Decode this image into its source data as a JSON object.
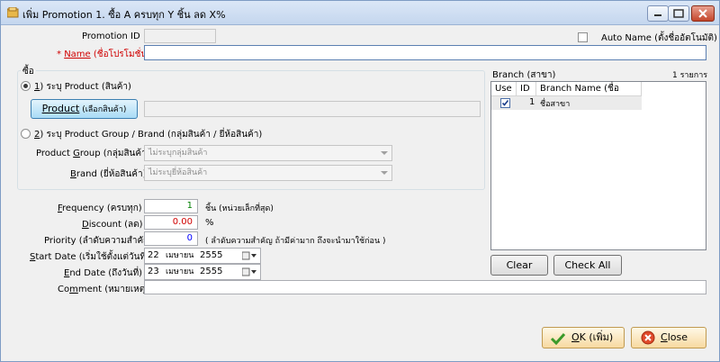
{
  "window": {
    "title": "เพิ่ม Promotion 1. ซื้อ A ครบทุก Y ชิ้น ลด X%"
  },
  "header": {
    "promotion_id_label": "Promotion ID",
    "promotion_id_value": "",
    "auto_name_label": "Auto Name (ตั้งชื่ออัตโนมัติ)",
    "name_asterisk": "* ",
    "name_label": "Name",
    "name_suffix": " (ชื่อโปรโมชั่น)",
    "name_value": ""
  },
  "buy_group": {
    "legend": "ซื้อ",
    "option1_num": "1",
    "option1_text": ") ระบุ Product (สินค้า)",
    "product_button_u": "Product",
    "product_button_rest": " (เลือกสินค้า)",
    "product_value": "",
    "option2_num": "2",
    "option2_text": ") ระบุ Product Group / Brand (กลุ่มสินค้า / ยี่ห้อสินค้า)",
    "product_group_u": "G",
    "product_group_label_pre": "Product ",
    "product_group_label_post": "roup (กลุ่มสินค้า)",
    "product_group_value": "ไม่ระบุกลุ่มสินค้า",
    "brand_u": "B",
    "brand_label_post": "rand (ยี่ห้อสินค้า)",
    "brand_value": "ไม่ระบุยี่ห้อสินค้า"
  },
  "params": {
    "frequency_u": "F",
    "frequency_label_post": "requency (ครบทุก)",
    "frequency_value": "1",
    "frequency_unit": "ชิ้น (หน่วยเล็กที่สุด)",
    "discount_u": "D",
    "discount_label_post": "iscount (ลด)",
    "discount_value": "0.00",
    "discount_unit": "%",
    "priority_label": "Priority (ลำดับความสำคัญ)",
    "priority_value": "0",
    "priority_hint": "( ลำดับความสำคัญ ถ้ามีค่ามาก ถึงจะนำมาใช้ก่อน )",
    "start_u": "S",
    "start_label_post": "tart Date (เริ่มใช้ตั้งแต่วันที่)",
    "start_day": "22",
    "start_month": "เมษายน",
    "start_year": "2555",
    "end_u": "E",
    "end_label_post": "nd Date (ถึงวันที่)",
    "end_day": "23",
    "end_month": "เมษายน",
    "end_year": "2555",
    "comment_label_pre": "Co",
    "comment_u": "m",
    "comment_label_post": "ment (หมายเหตุ)",
    "comment_value": ""
  },
  "branch": {
    "title": "Branch (สาขา)",
    "count": "1 รายการ",
    "columns": [
      "Use",
      "ID",
      "Branch Name  (ชื่อสาขา)"
    ],
    "rows": [
      {
        "use": true,
        "id": "1",
        "name": "ชื่อสาขา"
      }
    ],
    "clear_label": "Clear",
    "checkall_label": "Check All"
  },
  "footer": {
    "ok_u": "O",
    "ok_rest": "K (เพิ่ม)",
    "close_u": "C",
    "close_rest": "lose"
  },
  "colors": {
    "accent_blue": "#0000ff",
    "required_red": "#d00000",
    "frequency_green": "#008000"
  }
}
